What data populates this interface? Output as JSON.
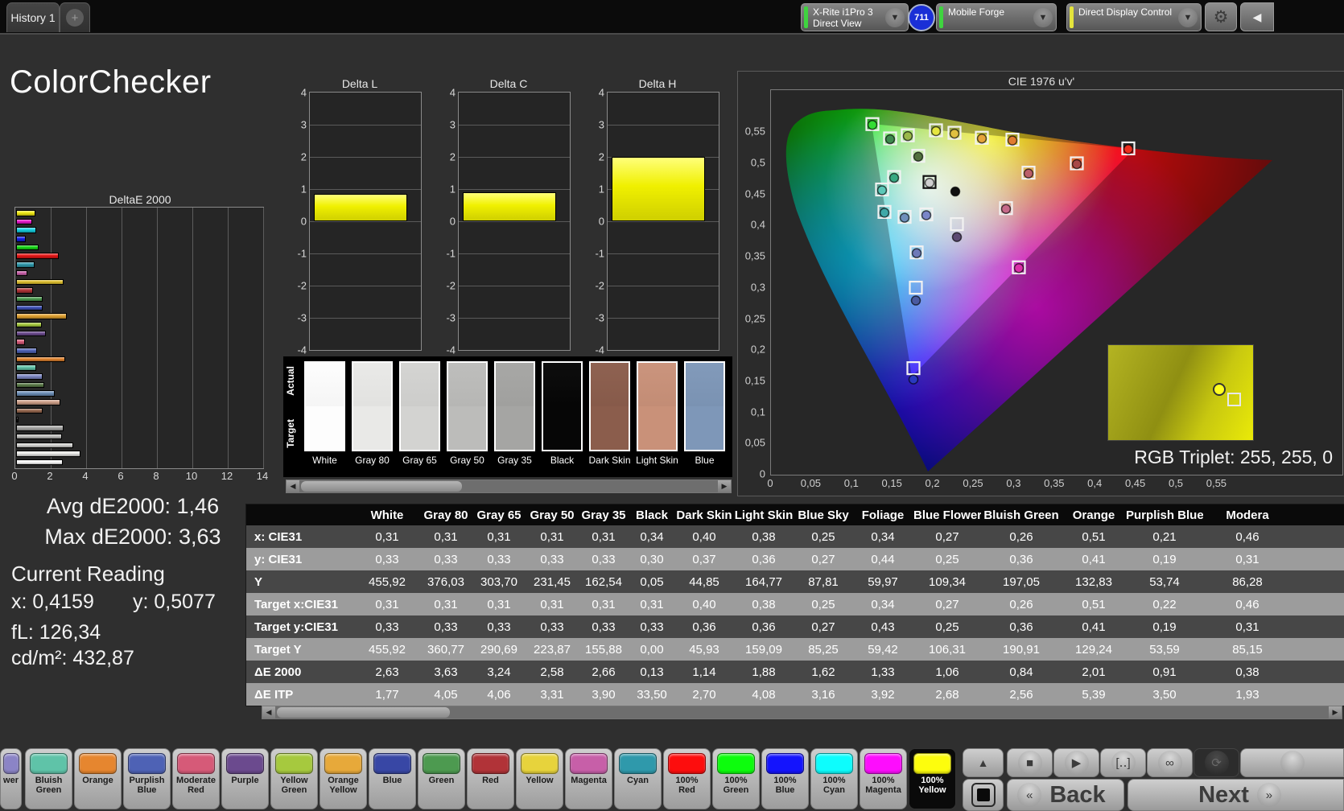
{
  "topbar": {
    "history_tab": "History 1",
    "add_tab": "+",
    "meter": {
      "line1": "X-Rite i1Pro 3",
      "line2": "Direct View",
      "badge": "711",
      "stripe": "#3fd43f"
    },
    "workflow": {
      "label": "Mobile Forge",
      "stripe": "#3fd43f"
    },
    "display": {
      "label": "Direct Display Control",
      "stripe": "#e4e43c"
    },
    "gear_icon": "⚙",
    "side_arrow_icon": "◀"
  },
  "title": "ColorChecker",
  "stats": {
    "avg": "Avg dE2000: 1,46",
    "max": "Max dE2000: 3,63",
    "current_title": "Current Reading",
    "x": "x: 0,4159",
    "y": "y: 0,5077",
    "fl": "fL: 126,34",
    "cd": "cd/m²: 432,87"
  },
  "charts": {
    "deltae": {
      "title": "DeltaE 2000",
      "xticks": [
        "0",
        "2",
        "4",
        "6",
        "8",
        "10",
        "12",
        "14"
      ],
      "max": 14,
      "bars": [
        {
          "label": "100% Yellow",
          "color": "#efe913",
          "value": 1.1
        },
        {
          "label": "100% Magenta",
          "color": "#e616c8",
          "value": 0.9
        },
        {
          "label": "100% Cyan",
          "color": "#16cfdf",
          "value": 1.15
        },
        {
          "label": "100% Blue",
          "color": "#1620e6",
          "value": 0.55
        },
        {
          "label": "100% Green",
          "color": "#16d816",
          "value": 1.25
        },
        {
          "label": "100% Red",
          "color": "#e61616",
          "value": 2.4
        },
        {
          "label": "Cyan",
          "color": "#2f99ab",
          "value": 1.05
        },
        {
          "label": "Magenta",
          "color": "#c75fa8",
          "value": 0.65
        },
        {
          "label": "Yellow",
          "color": "#dfc02f",
          "value": 2.7
        },
        {
          "label": "Red",
          "color": "#b13338",
          "value": 0.95
        },
        {
          "label": "Green",
          "color": "#4d9a50",
          "value": 1.5
        },
        {
          "label": "Blue",
          "color": "#3d50b5",
          "value": 1.5
        },
        {
          "label": "Orange Yellow",
          "color": "#dfa02f",
          "value": 2.85
        },
        {
          "label": "Yellow Green",
          "color": "#a6c93e",
          "value": 1.45
        },
        {
          "label": "Purple",
          "color": "#6b4a8e",
          "value": 1.7
        },
        {
          "label": "Moderate Red",
          "color": "#d65a78",
          "value": 0.5
        },
        {
          "label": "Purplish Blue",
          "color": "#4e62b5",
          "value": 1.2
        },
        {
          "label": "Orange",
          "color": "#e0832f",
          "value": 2.75
        },
        {
          "label": "Bluish Green",
          "color": "#5fc3a8",
          "value": 1.15
        },
        {
          "label": "Blue Flower",
          "color": "#7d88c4",
          "value": 1.5
        },
        {
          "label": "Foliage",
          "color": "#5a7a48",
          "value": 1.6
        },
        {
          "label": "Blue Sky",
          "color": "#6d8fb8",
          "value": 2.2
        },
        {
          "label": "Light Skin",
          "color": "#cfa089",
          "value": 2.5
        },
        {
          "label": "Dark Skin",
          "color": "#96684f",
          "value": 1.5
        },
        {
          "label": "Black",
          "color": "#141414",
          "value": 0.15
        },
        {
          "label": "Gray 35",
          "color": "#a8a8a6",
          "value": 2.66
        },
        {
          "label": "Gray 50",
          "color": "#bdbdbb",
          "value": 2.58
        },
        {
          "label": "Gray 65",
          "color": "#d3d3d1",
          "value": 3.24
        },
        {
          "label": "Gray 80",
          "color": "#e9e9e7",
          "value": 3.63
        },
        {
          "label": "White",
          "color": "#fdfdfd",
          "value": 2.63
        }
      ]
    },
    "lch_ticks": [
      "4",
      "3",
      "2",
      "1",
      "0",
      "-1",
      "-2",
      "-3",
      "-4"
    ],
    "lch": [
      {
        "title": "Delta L",
        "value": 0.85
      },
      {
        "title": "Delta C",
        "value": 0.9
      },
      {
        "title": "Delta H",
        "value": 2.0
      }
    ]
  },
  "swatches": {
    "row_label_top": "Actual",
    "row_label_bottom": "Target",
    "items": [
      {
        "label": "White",
        "color": "#fdfdfd"
      },
      {
        "label": "Gray 80",
        "color": "#e9e9e7"
      },
      {
        "label": "Gray 65",
        "color": "#d3d3d1"
      },
      {
        "label": "Gray 50",
        "color": "#bcbcba"
      },
      {
        "label": "Gray 35",
        "color": "#a5a5a3"
      },
      {
        "label": "Black",
        "color": "#060606"
      },
      {
        "label": "Dark Skin",
        "color": "#8b5d4c"
      },
      {
        "label": "Light Skin",
        "color": "#c99179"
      },
      {
        "label": "Blue",
        "color": "#7e97b8"
      }
    ]
  },
  "cie": {
    "title": "CIE 1976 u'v'",
    "xticks": [
      "0",
      "0,05",
      "0,1",
      "0,15",
      "0,2",
      "0,25",
      "0,3",
      "0,35",
      "0,4",
      "0,45",
      "0,5",
      "0,55"
    ],
    "yticks": [
      "0,55",
      "0,5",
      "0,45",
      "0,4",
      "0,35",
      "0,3",
      "0,25",
      "0,2",
      "0,15",
      "0,1",
      "0,05",
      "0"
    ],
    "rgb_triplet": "RGB Triplet: 255, 255, 0",
    "points": [
      {
        "u": 0.126,
        "v": 0.563,
        "c": "#33dd33"
      },
      {
        "u": 0.148,
        "v": 0.54,
        "c": "#3e8a4e"
      },
      {
        "u": 0.17,
        "v": 0.545,
        "c": "#9ab84a"
      },
      {
        "u": 0.183,
        "v": 0.512,
        "c": "#52703f"
      },
      {
        "u": 0.205,
        "v": 0.553,
        "c": "#e6e640"
      },
      {
        "u": 0.228,
        "v": 0.549,
        "c": "#e0c040"
      },
      {
        "u": 0.262,
        "v": 0.541,
        "c": "#e6a43a"
      },
      {
        "u": 0.3,
        "v": 0.538,
        "c": "#e07b30"
      },
      {
        "u": 0.444,
        "v": 0.524,
        "c": "#ee3020"
      },
      {
        "u": 0.38,
        "v": 0.5,
        "c": "#a84848"
      },
      {
        "u": 0.32,
        "v": 0.485,
        "c": "#bb5f6a"
      },
      {
        "u": 0.292,
        "v": 0.428,
        "c": "#c66a8a"
      },
      {
        "u": 0.308,
        "v": 0.333,
        "c": "#dd30aa"
      },
      {
        "u": 0.197,
        "v": 0.47,
        "c": "#cfcfcf",
        "frame": "black"
      },
      {
        "u": 0.229,
        "v": 0.456,
        "c": "#101010",
        "type": "circle"
      },
      {
        "u": 0.231,
        "v": 0.392,
        "c": "#5c4a72",
        "dy": 8
      },
      {
        "u": 0.181,
        "v": 0.357,
        "c": "#6e79b8"
      },
      {
        "u": 0.18,
        "v": 0.29,
        "c": "#4a5aa0",
        "dy": 8
      },
      {
        "u": 0.177,
        "v": 0.162,
        "c": "#2a3ac0",
        "dy": 7
      },
      {
        "u": 0.141,
        "v": 0.422,
        "c": "#3fa8a8"
      },
      {
        "u": 0.166,
        "v": 0.414,
        "c": "#6e8fbb"
      },
      {
        "u": 0.193,
        "v": 0.418,
        "c": "#7a86c8"
      },
      {
        "u": 0.153,
        "v": 0.478,
        "c": "#38a882"
      },
      {
        "u": 0.138,
        "v": 0.458,
        "c": "#5cc8b8"
      }
    ]
  },
  "table": {
    "columns": [
      "White",
      "Gray 80",
      "Gray 65",
      "Gray 50",
      "Gray 35",
      "Black",
      "Dark Skin",
      "Light Skin",
      "Blue Sky",
      "Foliage",
      "Blue Flower",
      "Bluish Green",
      "Orange",
      "Purplish Blue",
      "Modera"
    ],
    "rows": [
      {
        "label": "x: CIE31",
        "values": [
          "0,31",
          "0,31",
          "0,31",
          "0,31",
          "0,31",
          "0,34",
          "0,40",
          "0,38",
          "0,25",
          "0,34",
          "0,27",
          "0,26",
          "0,51",
          "0,21",
          "0,46"
        ]
      },
      {
        "label": "y: CIE31",
        "values": [
          "0,33",
          "0,33",
          "0,33",
          "0,33",
          "0,33",
          "0,30",
          "0,37",
          "0,36",
          "0,27",
          "0,44",
          "0,25",
          "0,36",
          "0,41",
          "0,19",
          "0,31"
        ]
      },
      {
        "label": "Y",
        "values": [
          "455,92",
          "376,03",
          "303,70",
          "231,45",
          "162,54",
          "0,05",
          "44,85",
          "164,77",
          "87,81",
          "59,97",
          "109,34",
          "197,05",
          "132,83",
          "53,74",
          "86,28"
        ]
      },
      {
        "label": "Target x:CIE31",
        "values": [
          "0,31",
          "0,31",
          "0,31",
          "0,31",
          "0,31",
          "0,31",
          "0,40",
          "0,38",
          "0,25",
          "0,34",
          "0,27",
          "0,26",
          "0,51",
          "0,22",
          "0,46"
        ]
      },
      {
        "label": "Target y:CIE31",
        "values": [
          "0,33",
          "0,33",
          "0,33",
          "0,33",
          "0,33",
          "0,33",
          "0,36",
          "0,36",
          "0,27",
          "0,43",
          "0,25",
          "0,36",
          "0,41",
          "0,19",
          "0,31"
        ]
      },
      {
        "label": "Target Y",
        "values": [
          "455,92",
          "360,77",
          "290,69",
          "223,87",
          "155,88",
          "0,00",
          "45,93",
          "159,09",
          "85,25",
          "59,42",
          "106,31",
          "190,91",
          "129,24",
          "53,59",
          "85,15"
        ]
      },
      {
        "label": "ΔE 2000",
        "values": [
          "2,63",
          "3,63",
          "3,24",
          "2,58",
          "2,66",
          "0,13",
          "1,14",
          "1,88",
          "1,62",
          "1,33",
          "1,06",
          "0,84",
          "2,01",
          "0,91",
          "0,38"
        ]
      },
      {
        "label": "ΔE ITP",
        "values": [
          "1,77",
          "4,05",
          "4,06",
          "3,31",
          "3,90",
          "33,50",
          "2,70",
          "4,08",
          "3,16",
          "3,92",
          "2,68",
          "2,56",
          "5,39",
          "3,50",
          "1,93"
        ]
      }
    ]
  },
  "toolbar": {
    "partial_patch": {
      "label": "wer",
      "color": "#8b84c6"
    },
    "patches": [
      {
        "label": "Bluish\nGreen",
        "color": "#5fc3a8"
      },
      {
        "label": "Orange",
        "color": "#e6862f"
      },
      {
        "label": "Purplish\nBlue",
        "color": "#4e62b5"
      },
      {
        "label": "Moderate\nRed",
        "color": "#d65a78"
      },
      {
        "label": "Purple",
        "color": "#6b4a8e"
      },
      {
        "label": "Yellow\nGreen",
        "color": "#a6c93e"
      },
      {
        "label": "Orange\nYellow",
        "color": "#e7a93a"
      },
      {
        "label": "Blue",
        "color": "#3847a5"
      },
      {
        "label": "Green",
        "color": "#4d9a50"
      },
      {
        "label": "Red",
        "color": "#b13338"
      },
      {
        "label": "Yellow",
        "color": "#e7d33c"
      },
      {
        "label": "Magenta",
        "color": "#c75fa8"
      },
      {
        "label": "Cyan",
        "color": "#2f99ab"
      },
      {
        "label": "100%\nRed",
        "color": "#fd0d0d"
      },
      {
        "label": "100%\nGreen",
        "color": "#0dfd0d"
      },
      {
        "label": "100%\nBlue",
        "color": "#1414fd"
      },
      {
        "label": "100%\nCyan",
        "color": "#0dfdfd"
      },
      {
        "label": "100%\nMagenta",
        "color": "#fd0dfd"
      },
      {
        "label": "100%\nYellow",
        "color": "#fdfd0d",
        "selected": true
      }
    ],
    "up_icon": "▲",
    "blackout_icon": "■",
    "transport": [
      {
        "name": "stop-icon",
        "glyph": "■"
      },
      {
        "name": "play-icon",
        "glyph": "▶"
      },
      {
        "name": "range-icon",
        "glyph": "[‥]"
      },
      {
        "name": "loop-icon",
        "glyph": "∞"
      },
      {
        "name": "refresh-icon",
        "glyph": "⟳",
        "dark": true
      }
    ],
    "back_chevron": "«",
    "back_label": "Back",
    "next_label": "Next",
    "next_chevron": "»"
  }
}
